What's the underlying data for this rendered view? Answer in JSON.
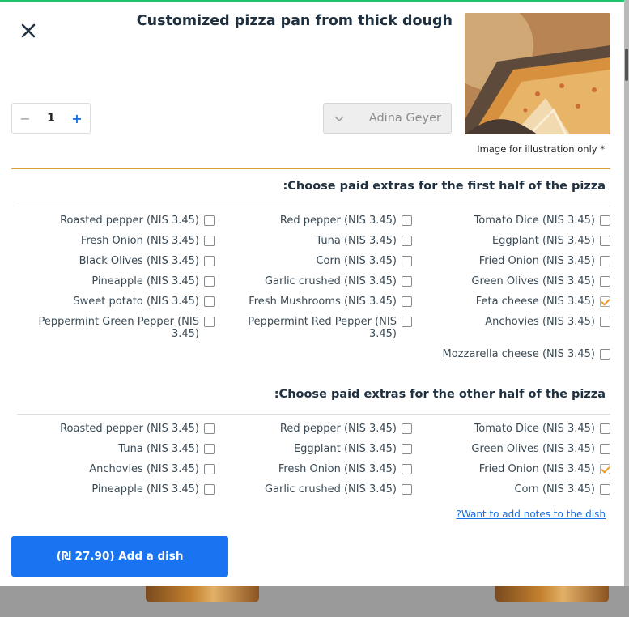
{
  "dish": {
    "title": "Customized pizza pan from thick dough",
    "image_note": "Image for illustration only *"
  },
  "quantity": {
    "minus": "−",
    "value": "1",
    "plus": "+"
  },
  "diner": {
    "value": "Adina Geyer"
  },
  "sections": [
    {
      "title": ":Choose paid extras for the first half of the pizza",
      "options": [
        {
          "label": "Tomato Dice (NIS 3.45)",
          "checked": false
        },
        {
          "label": "Red pepper (NIS 3.45)",
          "checked": false
        },
        {
          "label": "Roasted pepper (NIS 3.45)",
          "checked": false
        },
        {
          "label": "Eggplant (NIS 3.45)",
          "checked": false
        },
        {
          "label": "Tuna (NIS 3.45)",
          "checked": false
        },
        {
          "label": "Fresh Onion (NIS 3.45)",
          "checked": false
        },
        {
          "label": "Fried Onion (NIS 3.45)",
          "checked": false
        },
        {
          "label": "Corn (NIS 3.45)",
          "checked": false
        },
        {
          "label": "Black Olives (NIS 3.45)",
          "checked": false
        },
        {
          "label": "Green Olives (NIS 3.45)",
          "checked": false
        },
        {
          "label": "Garlic crushed (NIS 3.45)",
          "checked": false
        },
        {
          "label": "Pineapple (NIS 3.45)",
          "checked": false
        },
        {
          "label": "Feta cheese (NIS 3.45)",
          "checked": true
        },
        {
          "label": "Fresh Mushrooms (NIS 3.45)",
          "checked": false
        },
        {
          "label": "Sweet potato (NIS 3.45)",
          "checked": false
        },
        {
          "label": "Anchovies (NIS 3.45)",
          "checked": false
        },
        {
          "label": "Peppermint Red Pepper (NIS 3.45)",
          "checked": false
        },
        {
          "label": "Peppermint Green Pepper (NIS 3.45)",
          "checked": false
        },
        {
          "label": "Mozzarella cheese (NIS 3.45)",
          "checked": false
        }
      ]
    },
    {
      "title": ":Choose paid extras for the other half of the pizza",
      "options": [
        {
          "label": "Tomato Dice (NIS 3.45)",
          "checked": false
        },
        {
          "label": "Red pepper (NIS 3.45)",
          "checked": false
        },
        {
          "label": "Roasted pepper (NIS 3.45)",
          "checked": false
        },
        {
          "label": "Green Olives (NIS 3.45)",
          "checked": false
        },
        {
          "label": "Eggplant (NIS 3.45)",
          "checked": false
        },
        {
          "label": "Tuna (NIS 3.45)",
          "checked": false
        },
        {
          "label": "Fried Onion (NIS 3.45)",
          "checked": true
        },
        {
          "label": "Fresh Onion (NIS 3.45)",
          "checked": false
        },
        {
          "label": "Anchovies (NIS 3.45)",
          "checked": false
        },
        {
          "label": "Corn (NIS 3.45)",
          "checked": false
        },
        {
          "label": "Garlic crushed (NIS 3.45)",
          "checked": false
        },
        {
          "label": "Pineapple (NIS 3.45)",
          "checked": false
        }
      ]
    }
  ],
  "notes_link": "?Want to add notes to the dish",
  "add_button": "(₪ 27.90)  Add a dish",
  "icons": {
    "close": "close-icon",
    "dropdown": "chevron-down-icon"
  },
  "colors": {
    "accent": "#1a73f0",
    "top_border": "#1dc36f",
    "divider": "#d4a336",
    "check": "#f29a1e"
  }
}
